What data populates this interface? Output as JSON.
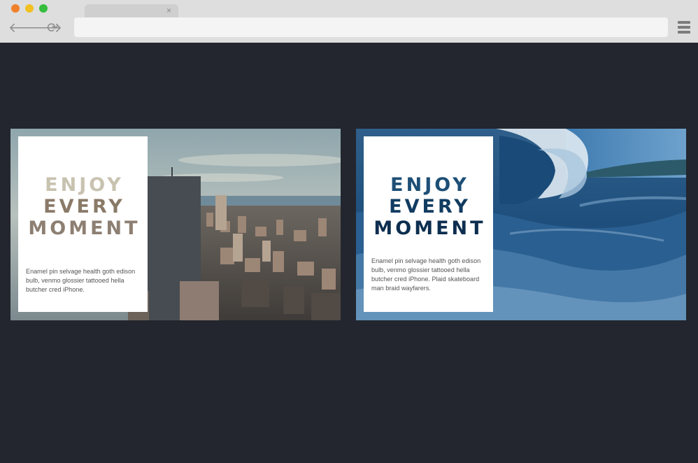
{
  "browser": {
    "tab": {
      "close_glyph": "×"
    },
    "address_bar": {
      "value": "",
      "placeholder": ""
    },
    "controls": {
      "traffic_lights": {
        "red": "#f0812c",
        "yellow": "#f2c025",
        "green": "#36bd3e"
      },
      "icons": [
        "back-arrow-icon",
        "forward-arrow-icon",
        "reload-icon",
        "hamburger-menu-icon"
      ]
    }
  },
  "page": {
    "background": "#23262e",
    "cards": [
      {
        "theme": "city",
        "headline": [
          "ENJOY",
          "EVERY",
          "MOMENT"
        ],
        "body": "Enamel pin selvage health goth edison bulb, venmo glossier tattooed hella butcher cred iPhone."
      },
      {
        "theme": "wave",
        "headline": [
          "ENJOY",
          "EVERY",
          "MOMENT"
        ],
        "body": "Enamel pin selvage health goth edison bulb, venmo glossier tattooed hella butcher cred iPhone. Plaid skateboard man braid wayfarers."
      }
    ]
  }
}
